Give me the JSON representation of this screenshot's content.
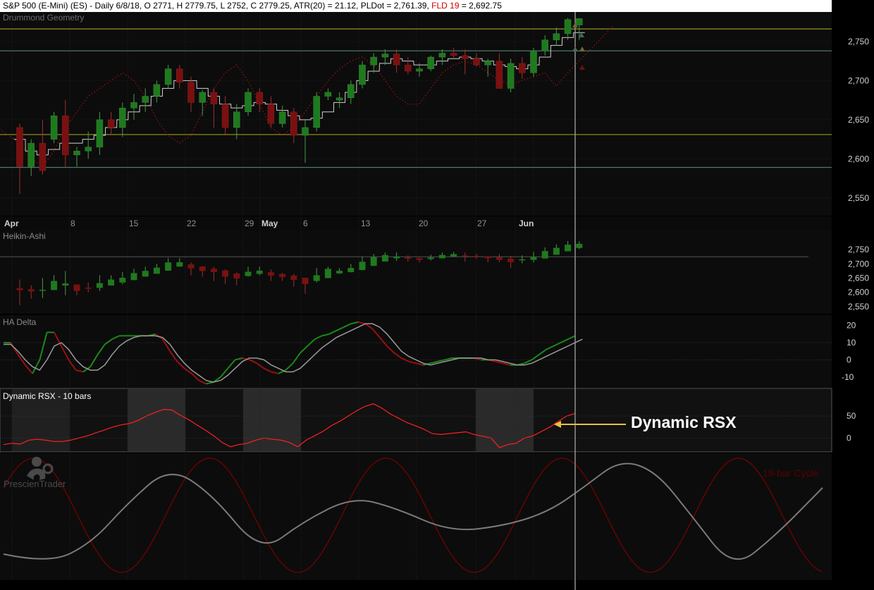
{
  "header": {
    "symbol": "S&P 500 (E-Mini) (ES) - Daily 6/8/18, O 2771, H 2779.75, L 2752, C 2779.25, ATR(20) = 21.12, PLDot = 2,761.39, ",
    "fld_label": "FLD 19",
    "fld_value": " = 2,692.75"
  },
  "annotation": {
    "text": "Dynamic RSX"
  },
  "logo": {
    "text": "PrescienTrader",
    "icon": "thinker-icon"
  },
  "colors": {
    "up": "#1e7a1e",
    "down": "#7a1010",
    "pldot": "#cfcfcf",
    "drummond_yellow": "#8a8a20",
    "drummond_teal": "#4a7a6a",
    "rsx": "#ff2020",
    "cycle_red": "#7a0000",
    "cycle_gray": "#7a7a7a",
    "axis_text": "#d0d0d0",
    "panel_label": "#8a8a8a"
  },
  "chart_data": [
    {
      "type": "candlestick",
      "panel_label": "Drummond Geometry",
      "yticks": [
        2550,
        2600,
        2650,
        2700,
        2750
      ],
      "ylim": [
        2530,
        2785
      ],
      "x_labels": [
        "Apr",
        "8",
        "15",
        "22",
        "29",
        "May",
        "6",
        "13",
        "20",
        "27",
        "Jun"
      ],
      "drummond_lines": [
        {
          "value": 2766,
          "color": "yellow"
        },
        {
          "value": 2738,
          "color": "teal"
        },
        {
          "value": 2631,
          "color": "yellow"
        },
        {
          "value": 2589,
          "color": "teal"
        }
      ],
      "candles": [
        [
          2640,
          2645,
          2555,
          2590
        ],
        [
          2590,
          2625,
          2578,
          2620
        ],
        [
          2620,
          2650,
          2580,
          2585
        ],
        [
          2625,
          2660,
          2620,
          2655
        ],
        [
          2655,
          2675,
          2590,
          2605
        ],
        [
          2605,
          2615,
          2590,
          2610
        ],
        [
          2610,
          2635,
          2600,
          2615
        ],
        [
          2615,
          2660,
          2605,
          2650
        ],
        [
          2650,
          2660,
          2630,
          2640
        ],
        [
          2640,
          2672,
          2628,
          2665
        ],
        [
          2665,
          2683,
          2650,
          2672
        ],
        [
          2672,
          2690,
          2660,
          2680
        ],
        [
          2680,
          2700,
          2672,
          2695
        ],
        [
          2695,
          2720,
          2690,
          2715
        ],
        [
          2715,
          2720,
          2690,
          2698
        ],
        [
          2698,
          2705,
          2660,
          2672
        ],
        [
          2672,
          2688,
          2655,
          2685
        ],
        [
          2685,
          2690,
          2640,
          2670
        ],
        [
          2670,
          2680,
          2630,
          2640
        ],
        [
          2640,
          2670,
          2625,
          2660
        ],
        [
          2660,
          2690,
          2655,
          2685
        ],
        [
          2685,
          2690,
          2660,
          2670
        ],
        [
          2670,
          2680,
          2640,
          2645
        ],
        [
          2645,
          2668,
          2640,
          2660
        ],
        [
          2660,
          2665,
          2620,
          2630
        ],
        [
          2630,
          2650,
          2595,
          2640
        ],
        [
          2640,
          2685,
          2635,
          2680
        ],
        [
          2680,
          2690,
          2675,
          2685
        ],
        [
          2675,
          2685,
          2665,
          2678
        ],
        [
          2678,
          2700,
          2670,
          2695
        ],
        [
          2695,
          2725,
          2690,
          2720
        ],
        [
          2720,
          2735,
          2710,
          2730
        ],
        [
          2730,
          2740,
          2720,
          2734
        ],
        [
          2734,
          2740,
          2710,
          2720
        ],
        [
          2720,
          2730,
          2708,
          2712
        ],
        [
          2712,
          2722,
          2705,
          2715
        ],
        [
          2715,
          2732,
          2712,
          2730
        ],
        [
          2730,
          2740,
          2720,
          2735
        ],
        [
          2735,
          2742,
          2728,
          2732
        ],
        [
          2732,
          2740,
          2708,
          2728
        ],
        [
          2728,
          2735,
          2718,
          2720
        ],
        [
          2720,
          2728,
          2705,
          2725
        ],
        [
          2725,
          2735,
          2705,
          2690
        ],
        [
          2690,
          2728,
          2685,
          2722
        ],
        [
          2722,
          2730,
          2702,
          2710
        ],
        [
          2710,
          2742,
          2705,
          2738
        ],
        [
          2738,
          2758,
          2732,
          2752
        ],
        [
          2752,
          2768,
          2745,
          2760
        ],
        [
          2760,
          2780,
          2752,
          2778
        ],
        [
          2771,
          2779.75,
          2752,
          2779.25
        ]
      ],
      "pldot": [
        2625,
        2610,
        2605,
        2612,
        2620,
        2620,
        2625,
        2630,
        2640,
        2650,
        2660,
        2668,
        2680,
        2690,
        2700,
        2700,
        2690,
        2680,
        2670,
        2665,
        2668,
        2672,
        2670,
        2662,
        2655,
        2650,
        2652,
        2660,
        2672,
        2685,
        2700,
        2712,
        2722,
        2728,
        2725,
        2720,
        2720,
        2725,
        2728,
        2730,
        2728,
        2725,
        2720,
        2718,
        2715,
        2720,
        2730,
        2745,
        2755,
        2761.39
      ],
      "fld": [
        2640,
        2630,
        2620,
        2600,
        2590,
        2610,
        2640,
        2660,
        2680,
        2690,
        2700,
        2710,
        2700,
        2680,
        2650,
        2630,
        2620,
        2630,
        2660,
        2690,
        2710,
        2720,
        2700,
        2670,
        2640,
        2630,
        2640,
        2660,
        2680,
        2700,
        2715,
        2725,
        2730,
        2720,
        2700,
        2680,
        2670,
        2670,
        2690,
        2710,
        2720,
        2725,
        2720,
        2710,
        2700,
        2695,
        2700,
        2705,
        2710,
        2692.75,
        2710,
        2725,
        2740,
        2755,
        2770
      ]
    },
    {
      "type": "candlestick",
      "panel_label": "Heikin-Ashi",
      "yticks": [
        2550,
        2600,
        2650,
        2700,
        2750
      ],
      "ylim": [
        2530,
        2785
      ],
      "reference_line": 2725
    },
    {
      "type": "line",
      "panel_label": "HA Delta",
      "yticks": [
        -10,
        0,
        10,
        20
      ],
      "ylim": [
        -15,
        24
      ],
      "series": [
        {
          "values": [
            10,
            10,
            3,
            -3,
            -8,
            0,
            16,
            16,
            8,
            0,
            -6,
            -7,
            -4,
            3,
            9,
            12,
            14,
            14,
            14,
            14,
            14,
            15,
            12,
            5,
            -1,
            -5,
            -8,
            -12,
            -14,
            -13,
            -10,
            -5,
            0,
            1,
            0,
            -2,
            -5,
            -7,
            -8,
            -6,
            -2,
            4,
            8,
            12,
            14,
            15,
            17,
            19,
            21,
            22,
            21,
            18,
            13,
            8,
            4,
            1,
            -1,
            -2,
            -3,
            -2,
            -1,
            0,
            1,
            1,
            1,
            1,
            0,
            0,
            -1,
            -2,
            -3,
            -3,
            -2,
            0,
            3,
            6,
            8,
            10,
            12,
            14
          ]
        },
        {
          "values": [
            9,
            9,
            5,
            0,
            -4,
            -6,
            0,
            8,
            10,
            6,
            0,
            -4,
            -6,
            -6,
            -3,
            3,
            8,
            11,
            13,
            14,
            14,
            14,
            13,
            9,
            3,
            -2,
            -6,
            -9,
            -12,
            -13,
            -12,
            -9,
            -5,
            -1,
            1,
            1,
            0,
            -3,
            -5,
            -7,
            -7,
            -5,
            -1,
            3,
            7,
            10,
            13,
            15,
            17,
            19,
            21,
            21,
            19,
            15,
            10,
            5,
            2,
            0,
            -2,
            -3,
            -2,
            -1,
            0,
            1,
            1,
            1,
            1,
            0,
            0,
            -1,
            -2,
            -3,
            -3,
            -2,
            0,
            2,
            4,
            6,
            8,
            10,
            12
          ]
        }
      ]
    },
    {
      "type": "line",
      "panel_label": "Dynamic RSX - 10 bars",
      "yticks": [
        0,
        50
      ],
      "ylim": [
        -30,
        105
      ],
      "values": [
        -15,
        -12,
        -14,
        -5,
        -3,
        -5,
        -8,
        -8,
        -5,
        0,
        5,
        12,
        18,
        25,
        30,
        33,
        40,
        50,
        58,
        65,
        64,
        52,
        42,
        30,
        18,
        5,
        -10,
        -20,
        -15,
        -12,
        -5,
        0,
        -3,
        -5,
        -10,
        -20,
        -5,
        5,
        15,
        28,
        38,
        50,
        62,
        72,
        78,
        68,
        55,
        45,
        35,
        28,
        20,
        10,
        8,
        10,
        12,
        14,
        8,
        4,
        0,
        -22,
        -15,
        -12,
        0,
        5,
        15,
        25,
        38,
        50,
        56
      ]
    },
    {
      "type": "line",
      "panel_label": "19-bar Cycle",
      "series": [
        {
          "name": "19-bar Cycle",
          "period_bars": 19
        },
        {
          "period_bars": 45
        }
      ]
    }
  ]
}
